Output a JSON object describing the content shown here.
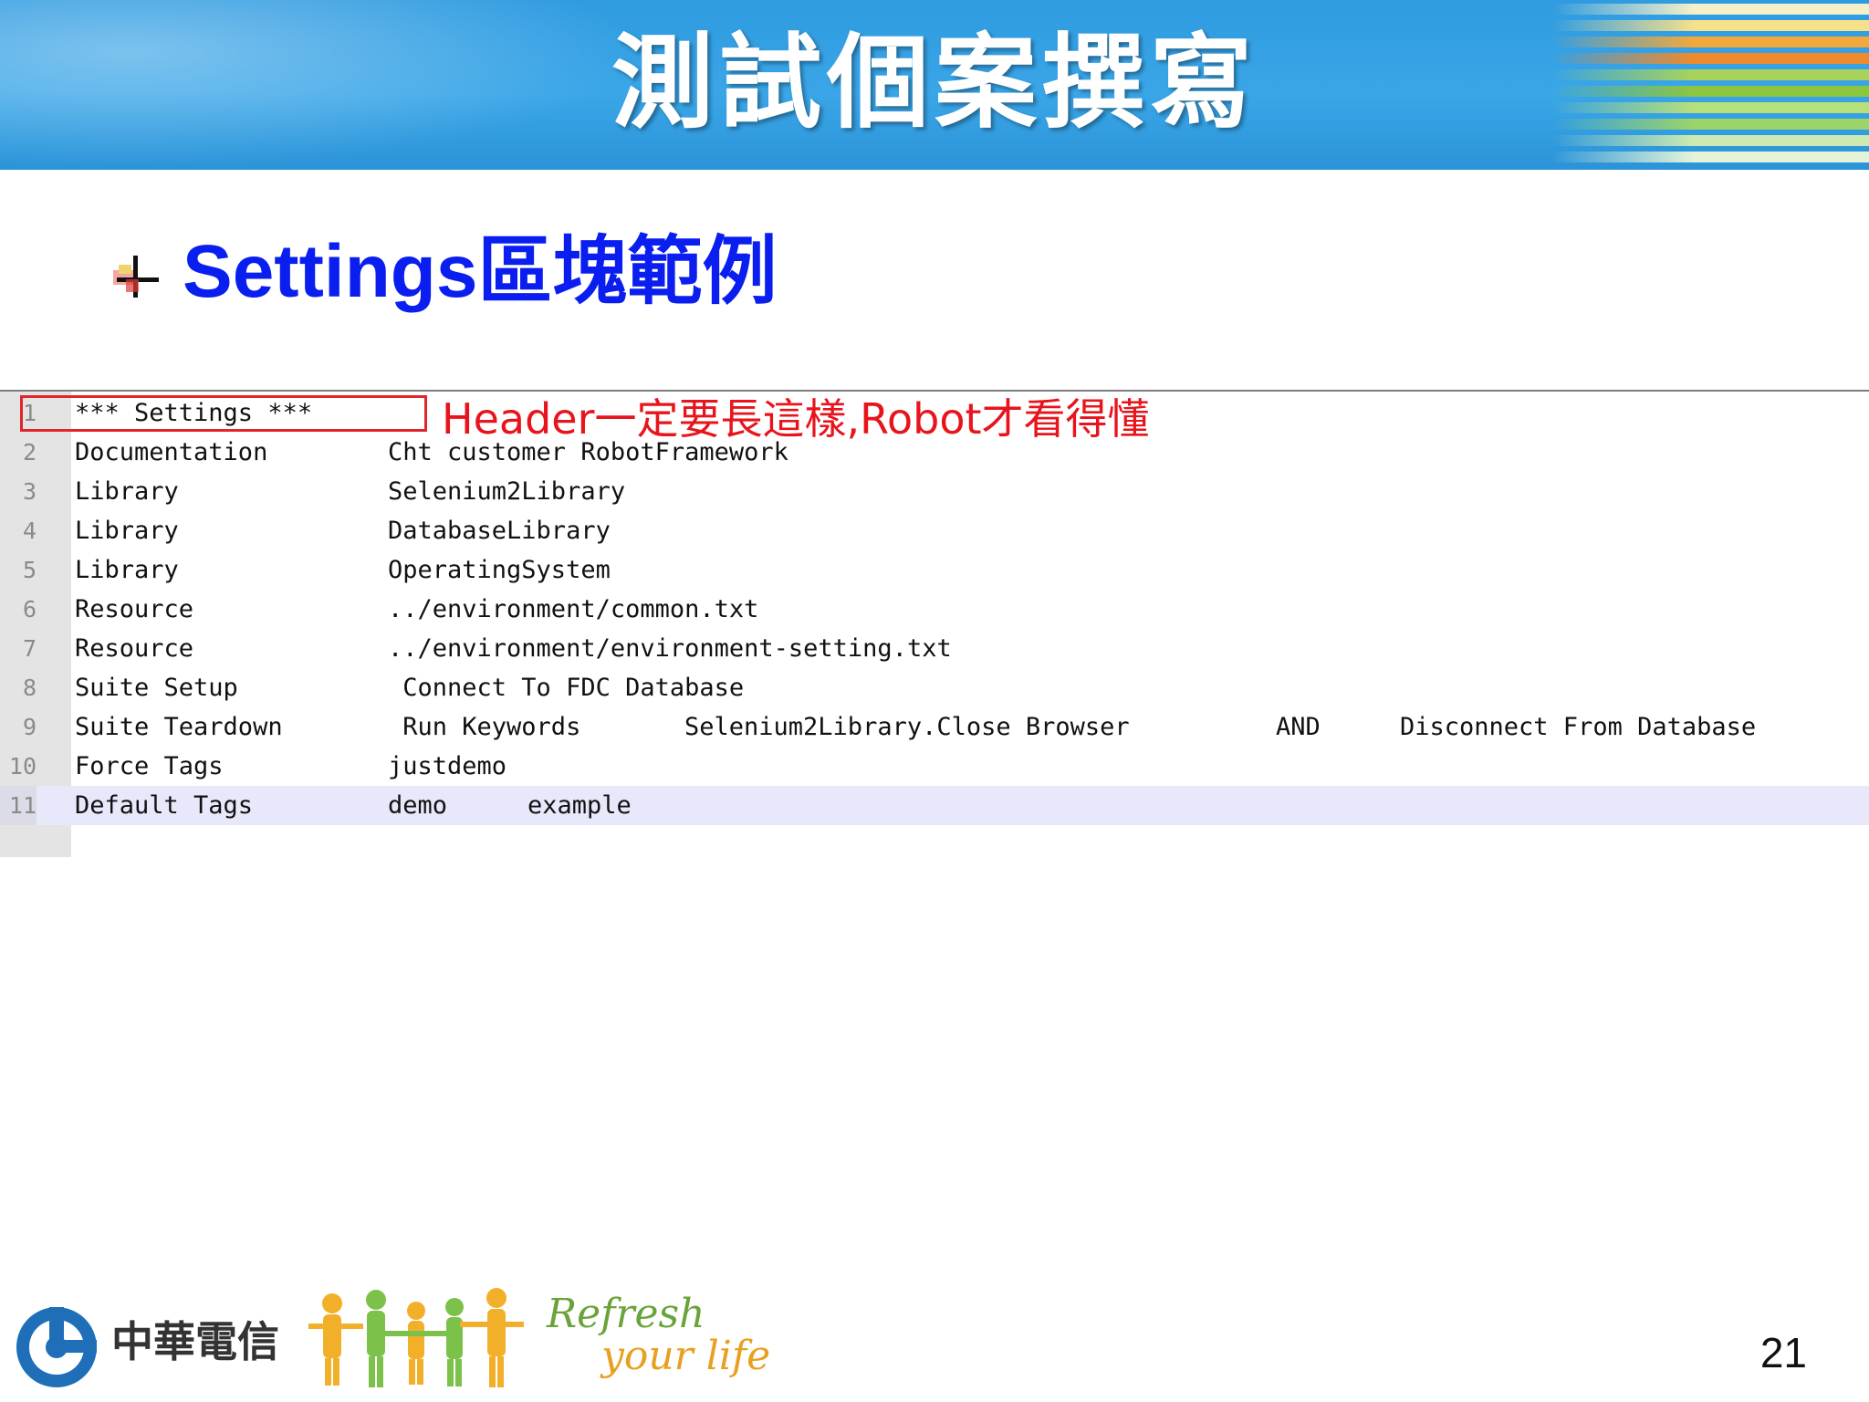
{
  "slide": {
    "title": "測試個案撰寫",
    "subtitle": "Settings區塊範例",
    "page_number": "21"
  },
  "code": {
    "rows": [
      {
        "ln": "1",
        "c1": "*** Settings ***"
      },
      {
        "ln": "2",
        "c1": "Documentation",
        "c2": "Cht customer RobotFramework"
      },
      {
        "ln": "3",
        "c1": "Library",
        "c2": "Selenium2Library"
      },
      {
        "ln": "4",
        "c1": "Library",
        "c2": "DatabaseLibrary"
      },
      {
        "ln": "5",
        "c1": "Library",
        "c2": "OperatingSystem"
      },
      {
        "ln": "6",
        "c1": "Resource",
        "c2": "../environment/common.txt"
      },
      {
        "ln": "7",
        "c1": "Resource",
        "c2": "../environment/environment-setting.txt"
      },
      {
        "ln": "8",
        "c1": "Suite Setup",
        "c2": " Connect To FDC Database"
      },
      {
        "ln": "9",
        "c1": "Suite Teardown",
        "c2": " Run Keywords",
        "c3": "Selenium2Library.Close Browser",
        "c4": "AND",
        "c5": "Disconnect From Database"
      },
      {
        "ln": "10",
        "c1": "Force Tags",
        "c2": "justdemo"
      },
      {
        "ln": "11",
        "c1": "Default Tags",
        "c2": "demo",
        "c3": "example"
      }
    ],
    "highlighted_row": "11"
  },
  "annotation": {
    "text": "Header一定要長這樣,Robot才看得懂",
    "color": "#e8141c"
  },
  "footer": {
    "brand": "中華電信",
    "tagline_line1": "Refresh",
    "tagline_line2": "your life"
  },
  "colors": {
    "header_band": "#3aa6e8",
    "subtitle": "#0a1ef0",
    "highlight_box": "#e0262a"
  }
}
